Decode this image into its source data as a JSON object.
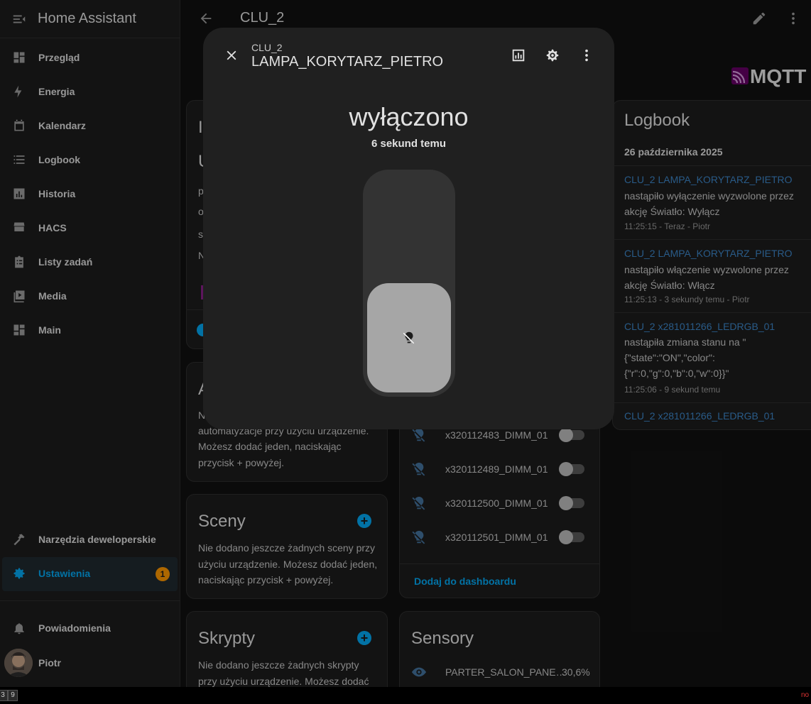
{
  "sidebar": {
    "title": "Home Assistant",
    "items": [
      {
        "label": "Przegląd"
      },
      {
        "label": "Energia"
      },
      {
        "label": "Kalendarz"
      },
      {
        "label": "Logbook"
      },
      {
        "label": "Historia"
      },
      {
        "label": "HACS"
      },
      {
        "label": "Listy zadań"
      },
      {
        "label": "Media"
      },
      {
        "label": "Main"
      }
    ],
    "dev_tools": "Narzędzia deweloperskie",
    "settings": "Ustawienia",
    "settings_badge": "1",
    "notifications": "Powiadomienia",
    "user": "Piotr"
  },
  "topbar": {
    "title": "CLU_2"
  },
  "mqtt_logo": "MQTT",
  "left_cards": {
    "info_partial": {
      "h1": "I",
      "h2": "U",
      "lines": [
        "p",
        "o",
        "s",
        "N"
      ]
    },
    "automations": {
      "title_partial": "A",
      "text": [
        "N",
        "automatyzacje przy użyciu urządzenie.",
        "Możesz dodać jeden, naciskając",
        "przycisk + powyżej."
      ]
    },
    "scenes": {
      "title": "Sceny",
      "text": "Nie dodano jeszcze żadnych sceny przy użyciu urządzenie. Możesz dodać jeden, naciskając przycisk + powyżej."
    },
    "scripts": {
      "title": "Skrypty",
      "text": "Nie dodano jeszcze żadnych skrypty przy użyciu urządzenie. Możesz dodać"
    }
  },
  "controls": {
    "rows": [
      {
        "name": "x320112483_DIMM_01"
      },
      {
        "name": "x320112489_DIMM_01"
      },
      {
        "name": "x320112500_DIMM_01"
      },
      {
        "name": "x320112501_DIMM_01"
      }
    ],
    "add_dashboard": "Dodaj do dashboardu"
  },
  "sensors": {
    "title": "Sensory",
    "row": {
      "name": "PARTER_SALON_PANE…",
      "value": "30,6%"
    }
  },
  "logbook": {
    "title": "Logbook",
    "date": "26 października 2025",
    "entries": [
      {
        "link": "CLU_2 LAMPA_KORYTARZ_PIETRO",
        "desc": "nastąpiło wyłączenie wyzwolone przez akcję Światło: Wyłącz",
        "time": "11:25:15 - Teraz - Piotr"
      },
      {
        "link": "CLU_2 LAMPA_KORYTARZ_PIETRO",
        "desc": "nastąpiło włączenie wyzwolone przez akcję Światło: Włącz",
        "time": "11:25:13 - 3 sekundy temu - Piotr"
      },
      {
        "link": "CLU_2 x281011266_LEDRGB_01",
        "desc": "nastąpiła zmiana stanu na \"{\"state\":\"ON\",\"color\": {\"r\":0,\"g\":0,\"b\":0,\"w\":0}}\"",
        "time": "11:25:06 - 9 sekund temu"
      },
      {
        "link": "CLU_2 x281011266_LEDRGB_01"
      }
    ]
  },
  "dialog": {
    "subtitle": "CLU_2",
    "title": "LAMPA_KORYTARZ_PIETRO",
    "state": "wyłączono",
    "ago": "6 sekund temu",
    "brightness_fraction": 0.5
  },
  "statusbar": {
    "boxes": [
      "3",
      "9"
    ],
    "right": "no"
  },
  "colors": {
    "accent": "#03a9f4",
    "badge": "#ff9800",
    "link": "#3d86c9"
  }
}
